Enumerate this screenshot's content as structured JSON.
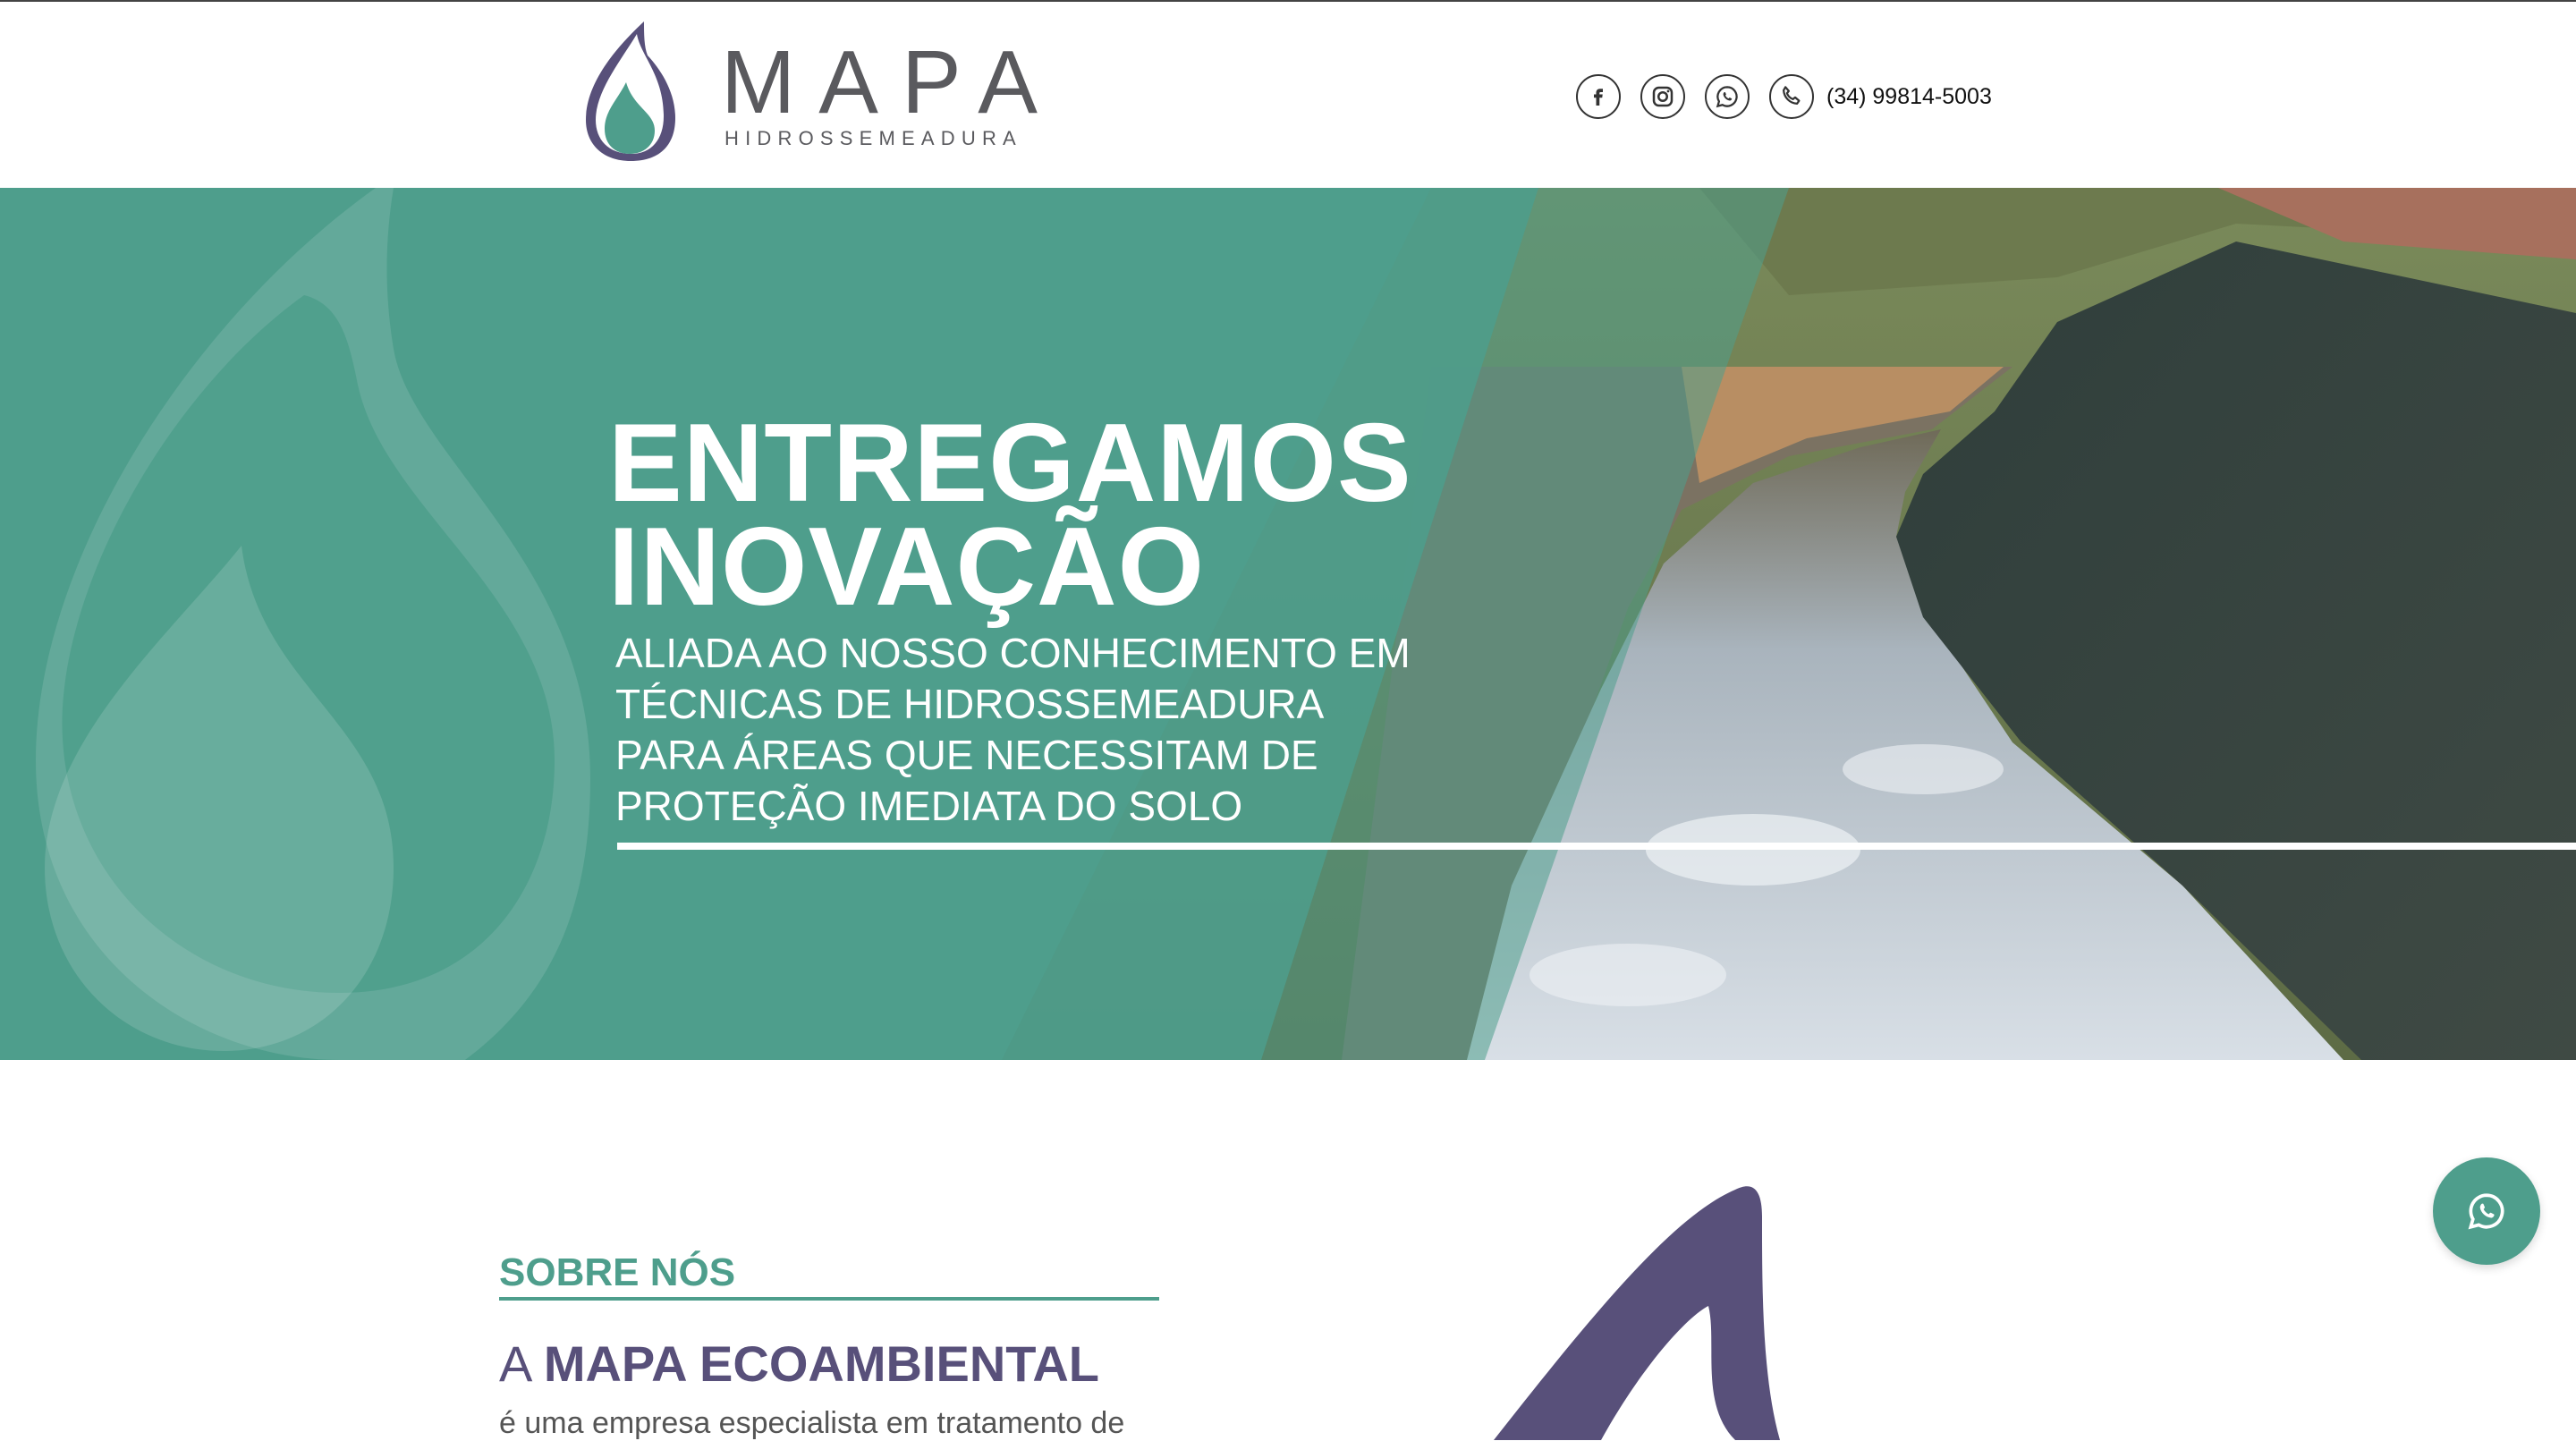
{
  "header": {
    "logo_title": "MAPA",
    "logo_subtitle": "HIDROSSEMEADURA",
    "phone": "(34) 99814-5003",
    "social_icons": [
      "facebook-icon",
      "instagram-icon",
      "whatsapp-icon",
      "phone-icon"
    ]
  },
  "hero": {
    "title_line1": "ENTREGAMOS",
    "title_line2": "INOVAÇÃO",
    "subtitle_lines": [
      "ALIADA AO NOSSO CONHECIMENTO EM",
      "TÉCNICAS DE HIDROSSEMEADURA",
      "PARA ÁREAS QUE NECESSITAM DE",
      "PROTEÇÃO IMEDIATA DO SOLO"
    ]
  },
  "about": {
    "label": "SOBRE NÓS",
    "heading_prefix": "A",
    "heading_bold": "MAPA ECOAMBIENTAL",
    "text": "é uma empresa especialista em tratamento de"
  },
  "floating": {
    "whatsapp_icon": "whatsapp-icon"
  },
  "colors": {
    "teal": "#4e9e8c",
    "purple": "#58507a",
    "gray_logo": "#5a5a5e"
  }
}
